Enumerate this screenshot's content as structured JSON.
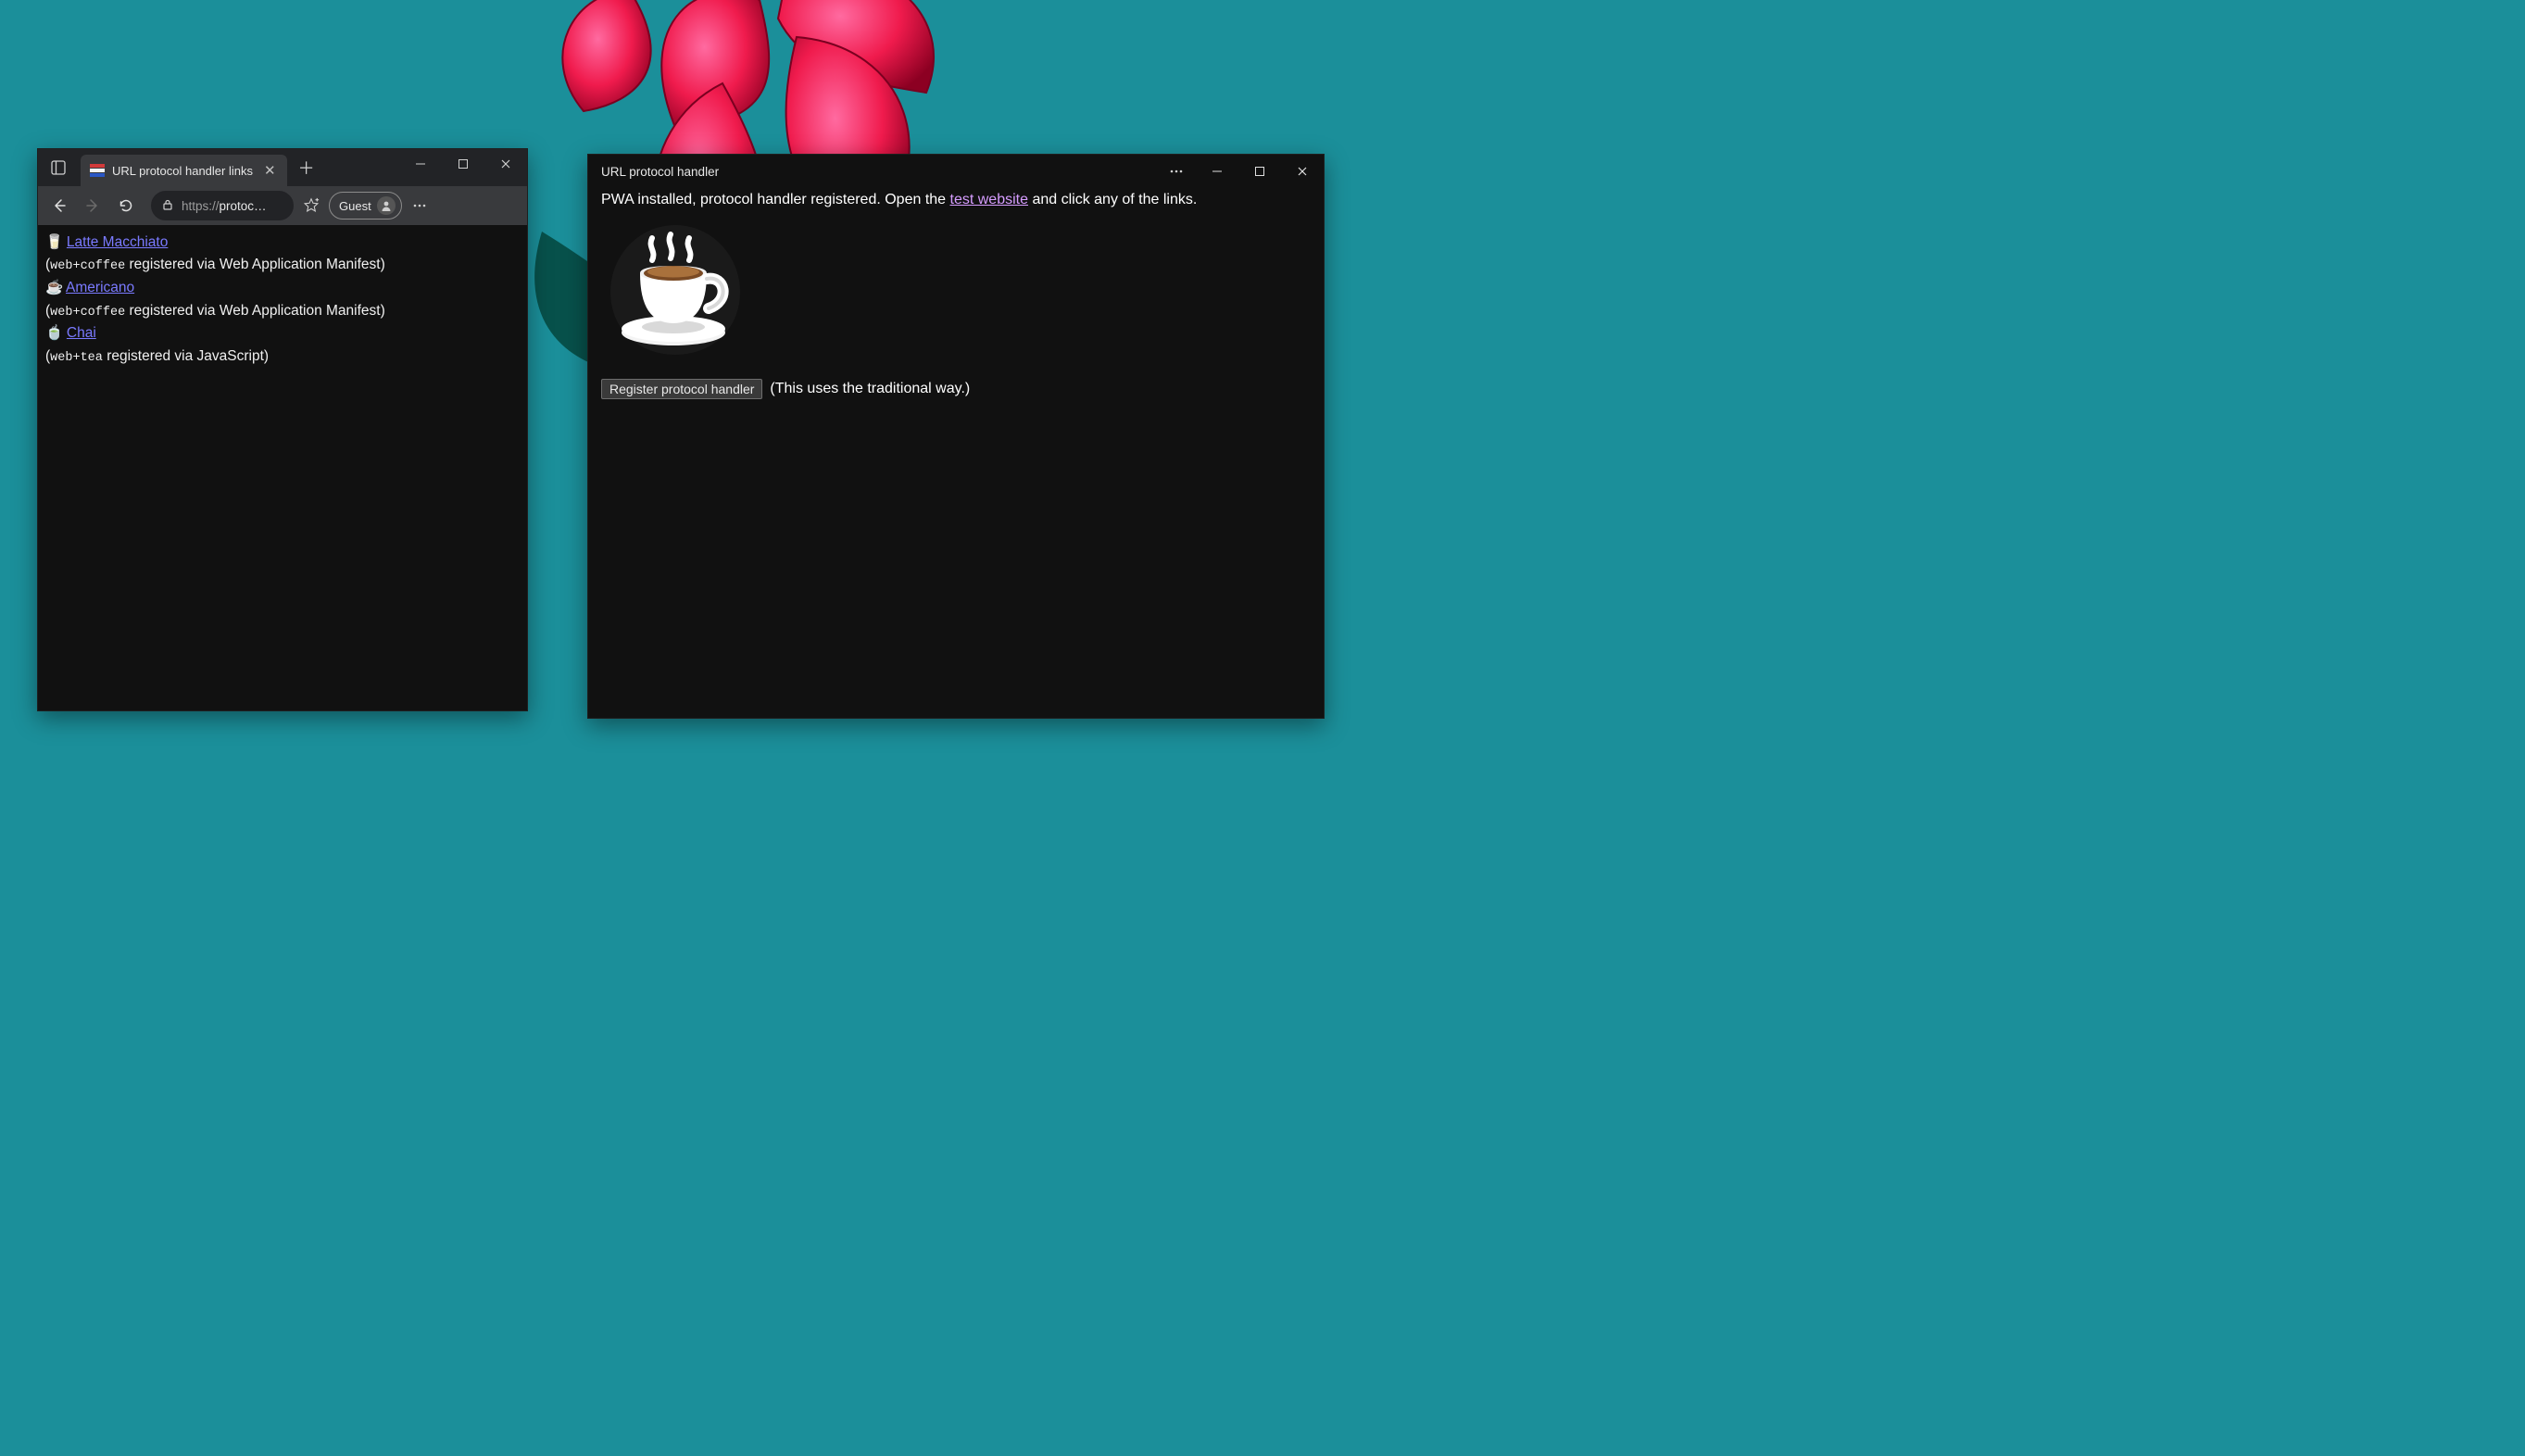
{
  "browser": {
    "tab_title": "URL protocol handler links",
    "url_display": "https://protoc…",
    "guest_label": "Guest",
    "page": {
      "links": [
        {
          "emoji": "🥛",
          "label": "Latte Macchiato",
          "protocol": "web+coffee",
          "via": " registered via Web Application Manifest)"
        },
        {
          "emoji": "☕",
          "label": "Americano",
          "protocol": "web+coffee",
          "via": " registered via Web Application Manifest)"
        },
        {
          "emoji": "🍵",
          "label": "Chai",
          "protocol": "web+tea",
          "via": " registered via JavaScript)"
        }
      ]
    }
  },
  "pwa": {
    "title": "URL protocol handler",
    "intro_prefix": "PWA installed, protocol handler registered. Open the ",
    "intro_link": "test website",
    "intro_suffix": " and click any of the links.",
    "register_button": "Register protocol handler",
    "register_note": "(This uses the traditional way.)"
  }
}
